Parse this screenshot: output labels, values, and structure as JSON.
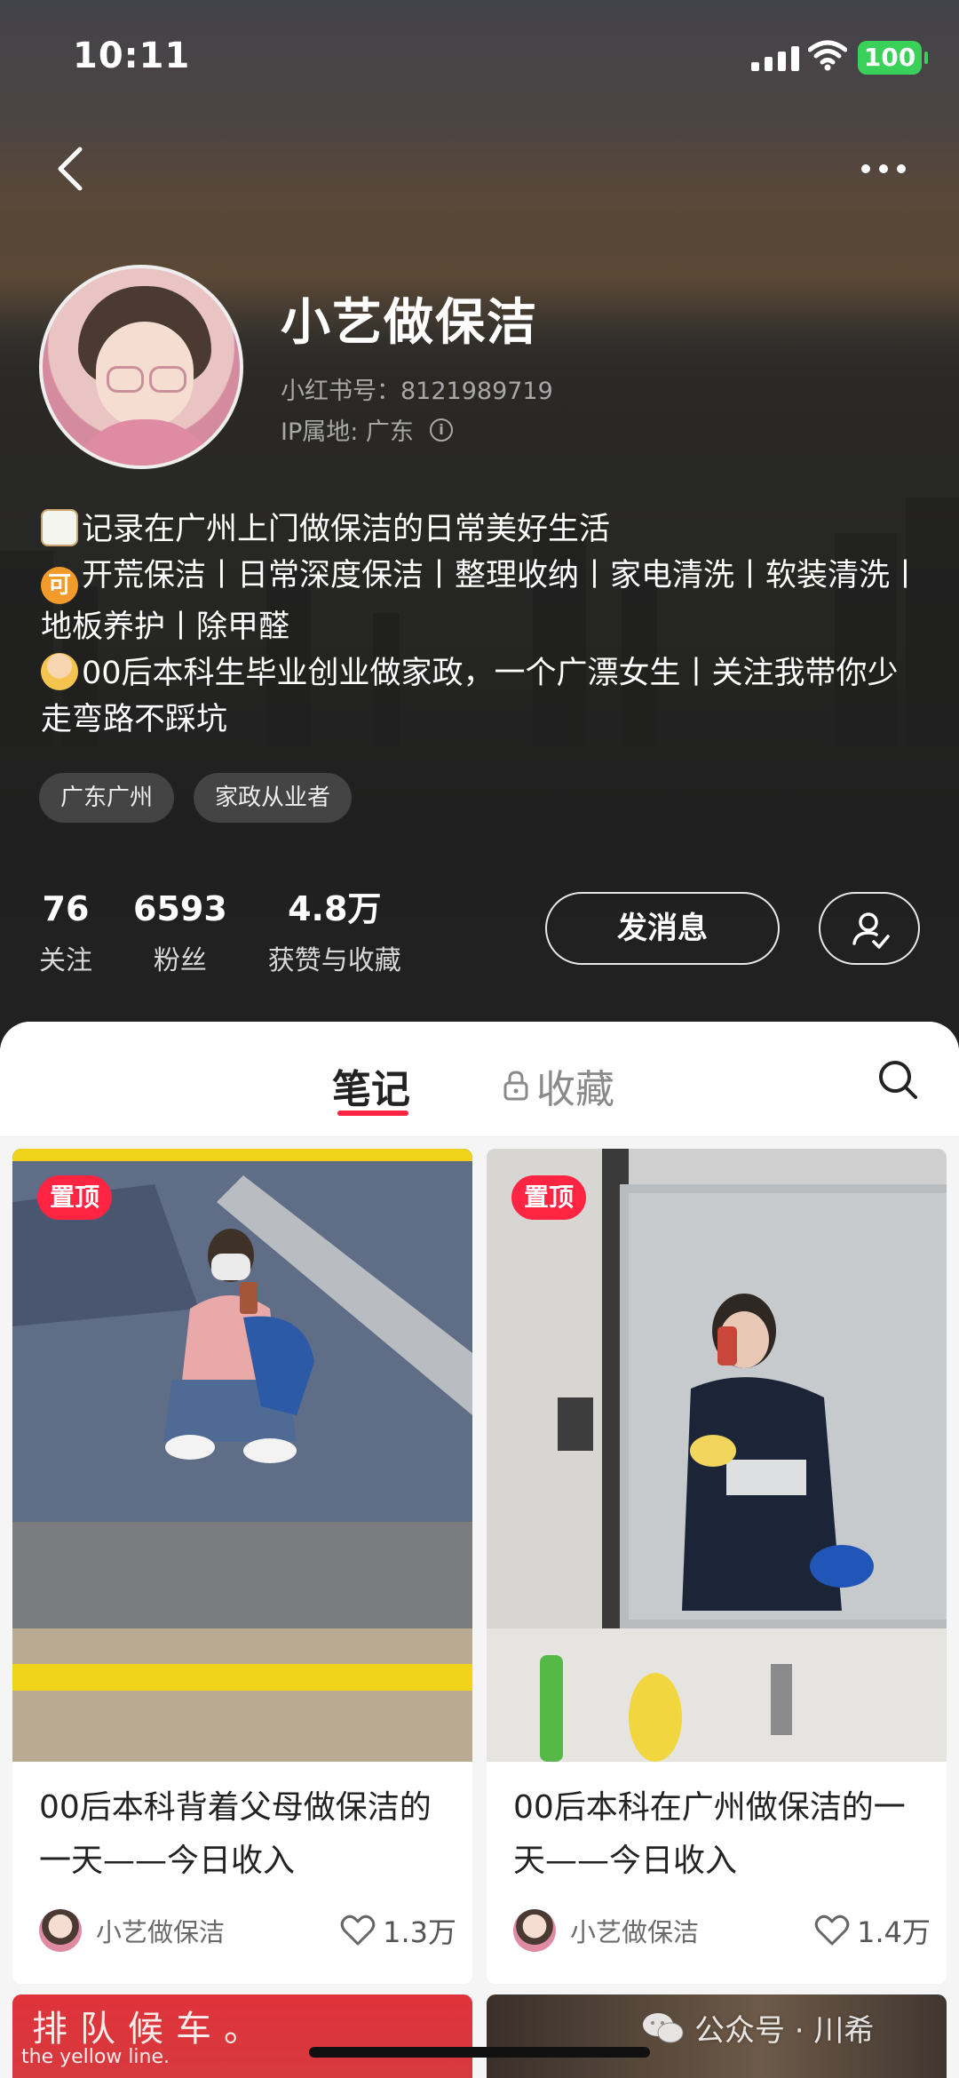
{
  "status_bar": {
    "time": "10:11",
    "battery": "100"
  },
  "profile": {
    "name": "小艺做保洁",
    "id_label": "小红书号：8121989719",
    "ip_label": "IP属地: 广东",
    "bio_lines": [
      "记录在广州上门做保洁的日常美好生活",
      "开荒保洁丨日常深度保洁丨整理收纳丨家电清洗丨软装清洗丨地板养护丨除甲醛",
      "00后本科生毕业创业做家政，一个广漂女生丨关注我带你少走弯路不踩坑"
    ],
    "bio_emoji_ke": "可",
    "tags": [
      "广东广州",
      "家政从业者"
    ],
    "stats": [
      {
        "value": "76",
        "label": "关注"
      },
      {
        "value": "6593",
        "label": "粉丝"
      },
      {
        "value": "4.8万",
        "label": "获赞与收藏"
      }
    ],
    "message_button": "发消息"
  },
  "tabs": {
    "notes": "笔记",
    "favorites": "收藏"
  },
  "notes": [
    {
      "pin": "置顶",
      "title": "00后本科背着父母做保洁的一天——今日收入",
      "author": "小艺做保洁",
      "likes": "1.3万"
    },
    {
      "pin": "置顶",
      "title": "00后本科在广州做保洁的一天——今日收入",
      "author": "小艺做保洁",
      "likes": "1.4万"
    }
  ],
  "bottom_previews": {
    "left_big": "排队候车。",
    "left_small": "the yellow line."
  },
  "watermark": "公众号 · 川希",
  "colors": {
    "accent": "#ff2442",
    "header_bg": "#222222"
  }
}
